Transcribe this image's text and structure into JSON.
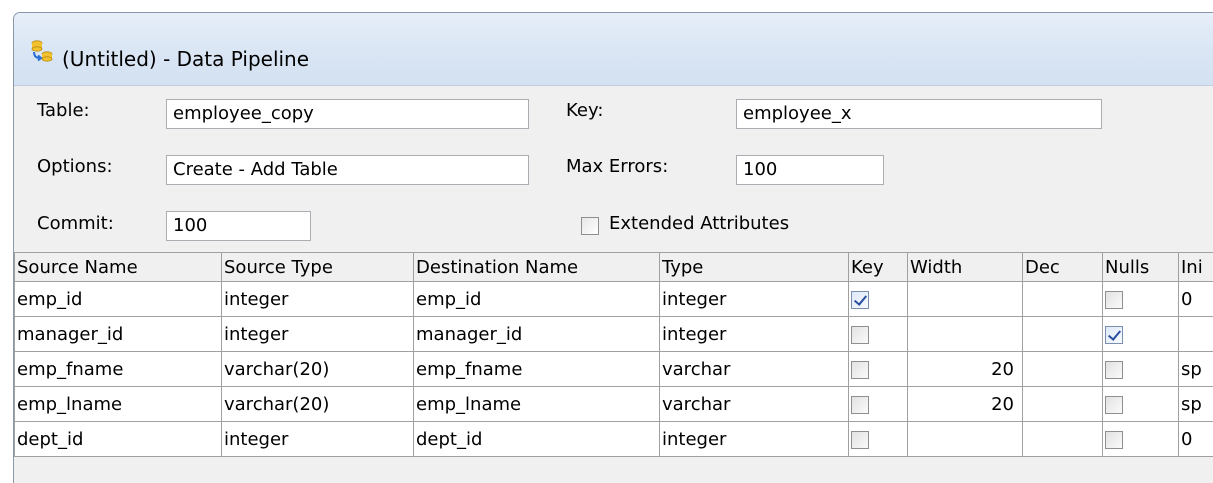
{
  "window": {
    "title": "(Untitled) - Data Pipeline"
  },
  "form": {
    "table_label": "Table:",
    "table_value": "employee_copy",
    "key_label": "Key:",
    "key_value": "employee_x",
    "options_label": "Options:",
    "options_value": "Create - Add Table",
    "max_errors_label": "Max Errors:",
    "max_errors_value": "100",
    "commit_label": "Commit:",
    "commit_value": "100",
    "extended_attributes_label": "Extended Attributes",
    "extended_attributes_checked": false
  },
  "grid": {
    "columns": [
      "Source Name",
      "Source Type",
      "Destination Name",
      "Type",
      "Key",
      "Width",
      "Dec",
      "Nulls",
      "Ini"
    ],
    "rows": [
      {
        "source_name": "emp_id",
        "source_type": "integer",
        "destination_name": "emp_id",
        "type": "integer",
        "key": true,
        "width": "",
        "dec": "",
        "nulls": false,
        "initial": "0"
      },
      {
        "source_name": "manager_id",
        "source_type": "integer",
        "destination_name": "manager_id",
        "type": "integer",
        "key": false,
        "width": "",
        "dec": "",
        "nulls": true,
        "initial": ""
      },
      {
        "source_name": "emp_fname",
        "source_type": "varchar(20)",
        "destination_name": "emp_fname",
        "type": "varchar",
        "key": false,
        "width": "20",
        "dec": "",
        "nulls": false,
        "initial": "sp"
      },
      {
        "source_name": "emp_lname",
        "source_type": "varchar(20)",
        "destination_name": "emp_lname",
        "type": "varchar",
        "key": false,
        "width": "20",
        "dec": "",
        "nulls": false,
        "initial": "sp"
      },
      {
        "source_name": "dept_id",
        "source_type": "integer",
        "destination_name": "dept_id",
        "type": "integer",
        "key": false,
        "width": "",
        "dec": "",
        "nulls": false,
        "initial": "0"
      }
    ]
  },
  "colors": {
    "titlebar": "#dae6f5",
    "form_background": "#f0f0f0",
    "grid_border": "#a0a0a0",
    "check_mark": "#2a4fa0"
  },
  "icons": {
    "app": "data-pipeline-icon"
  }
}
